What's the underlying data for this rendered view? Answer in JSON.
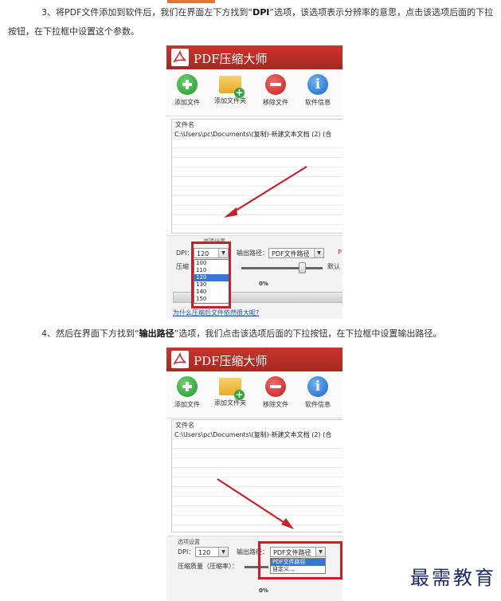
{
  "step3": {
    "prefix": "3、将PDF文件添加到软件后，我们在界面左下方找到“",
    "keyword": "DPI",
    "suffix": "”选项，该选项表示分辨率的意思，点击该选项后面的下拉按钮，在下拉框中设置这个参数。"
  },
  "step4": {
    "prefix": "4、然后在界面下方找到“",
    "keyword": "输出路径",
    "suffix": "”选项，我们点击该选项后面的下拉按钮，在下拉框中设置输出路径。"
  },
  "app": {
    "title": "PDF压缩大师",
    "toolbar": {
      "add_file": "添加文件",
      "add_folder": "添加文件夹",
      "remove_file": "移除文件",
      "software_info": "软件信息"
    },
    "list": {
      "column": "文件名",
      "path": "C:\\Users\\pc\\Documents\\(复制)-新建文本文档 (2) (合"
    },
    "options": {
      "section_title": "选项设置",
      "dpi_label": "DPI：",
      "dpi_value": "120",
      "output_label": "输出路径：",
      "output_value": "PDF文件路径",
      "quality_label_short": "压缩",
      "quality_label": "压缩质量（压缩率）：",
      "default_label": "默认",
      "dpi_options": [
        "100",
        "110",
        "120",
        "130",
        "140",
        "150"
      ],
      "dpi_selected": "120",
      "output_options": [
        "PDF文件路径",
        "自定义..."
      ],
      "output_selected": "PDF文件路径",
      "truncated_marker": "P"
    },
    "progress": "0%",
    "help_link": "为什么压缩后文件依然很大呢?"
  },
  "colors": {
    "title_bar": "#b82e26",
    "highlight": "#c8202a",
    "selection": "#3a75d4",
    "watermark": "#1d2a6e"
  },
  "watermark": "最需教育"
}
